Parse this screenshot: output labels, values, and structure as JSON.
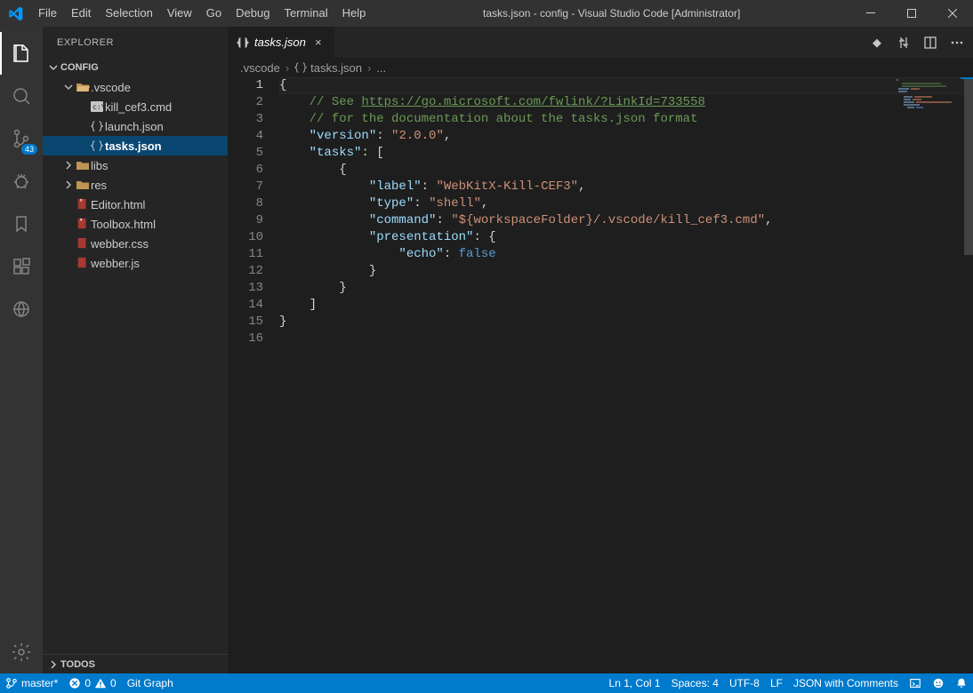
{
  "title": "tasks.json - config - Visual Studio Code [Administrator]",
  "menus": [
    "File",
    "Edit",
    "Selection",
    "View",
    "Go",
    "Debug",
    "Terminal",
    "Help"
  ],
  "activity": {
    "scm_badge": "43"
  },
  "sidebar": {
    "title": "EXPLORER",
    "section": "CONFIG",
    "tree": [
      {
        "kind": "folder",
        "label": ".vscode",
        "expanded": true,
        "indent": 1
      },
      {
        "kind": "file",
        "label": "kill_cef3.cmd",
        "icon": "cmd",
        "indent": 2
      },
      {
        "kind": "file",
        "label": "launch.json",
        "icon": "json",
        "indent": 2
      },
      {
        "kind": "file",
        "label": "tasks.json",
        "icon": "json",
        "indent": 2,
        "selected": true
      },
      {
        "kind": "folder",
        "label": "libs",
        "expanded": false,
        "indent": 1
      },
      {
        "kind": "folder",
        "label": "res",
        "expanded": false,
        "indent": 1
      },
      {
        "kind": "file",
        "label": "Editor.html",
        "icon": "html",
        "indent": 1
      },
      {
        "kind": "file",
        "label": "Toolbox.html",
        "icon": "html",
        "indent": 1
      },
      {
        "kind": "file",
        "label": "webber.css",
        "icon": "css",
        "indent": 1
      },
      {
        "kind": "file",
        "label": "webber.js",
        "icon": "js",
        "indent": 1
      }
    ],
    "todos": "TODOS"
  },
  "tab": {
    "label": "tasks.json"
  },
  "breadcrumbs": {
    "a": ".vscode",
    "b": "tasks.json",
    "c": "..."
  },
  "code": {
    "comment1_a": "// See ",
    "comment1_link": "https://go.microsoft.com/fwlink/?LinkId=733558",
    "comment2": "// for the documentation about the tasks.json format",
    "k_version": "\"version\"",
    "v_version": "\"2.0.0\"",
    "k_tasks": "\"tasks\"",
    "k_label": "\"label\"",
    "v_label": "\"WebKitX-Kill-CEF3\"",
    "k_type": "\"type\"",
    "v_type": "\"shell\"",
    "k_command": "\"command\"",
    "v_command": "\"${workspaceFolder}/.vscode/kill_cef3.cmd\"",
    "k_presentation": "\"presentation\"",
    "k_echo": "\"echo\"",
    "v_echo": "false"
  },
  "status": {
    "branch": "master*",
    "errors": "0",
    "warnings": "0",
    "gitgraph": "Git Graph",
    "lncol": "Ln 1, Col 1",
    "spaces": "Spaces: 4",
    "encoding": "UTF-8",
    "eol": "LF",
    "lang": "JSON with Comments"
  }
}
